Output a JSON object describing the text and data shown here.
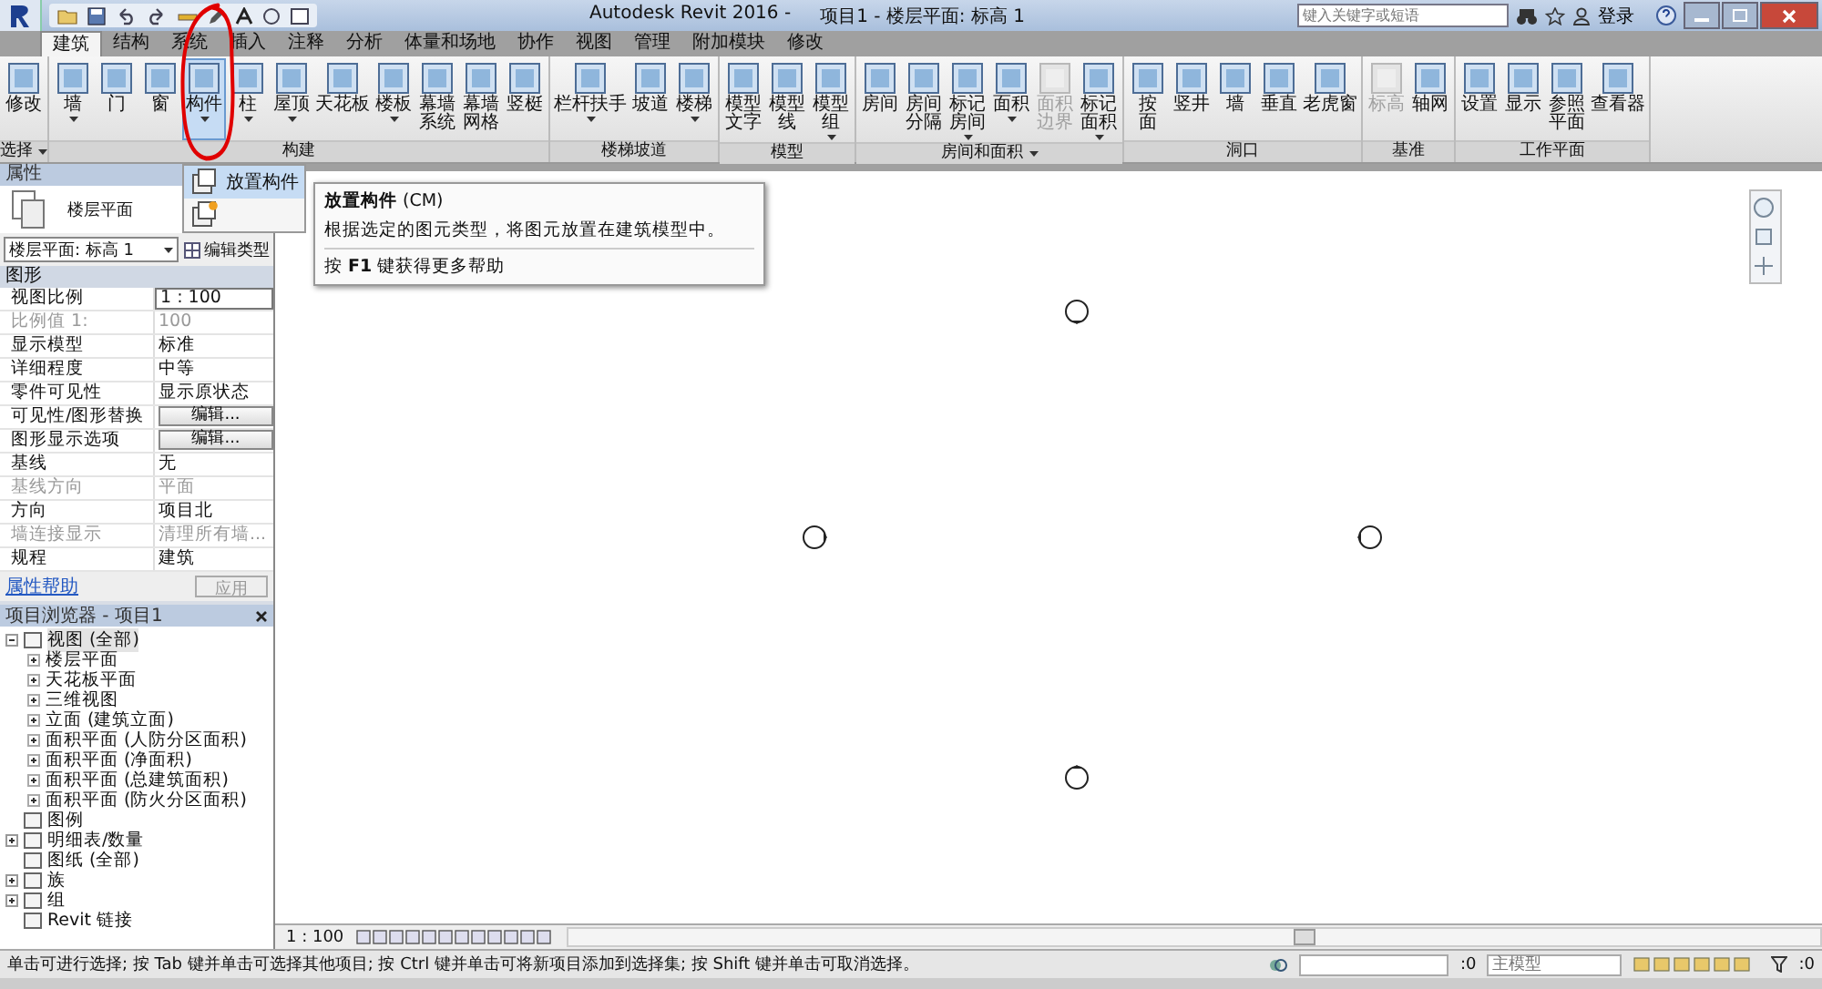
{
  "window": {
    "app_title": "Autodesk Revit 2016 -",
    "doc_title": "项目1 - 楼层平面: 标高 1",
    "search_placeholder": "键入关键字或短语",
    "login": "登录"
  },
  "tabs": [
    {
      "label": "建筑",
      "selected": true
    },
    {
      "label": "结构",
      "selected": false
    },
    {
      "label": "系统",
      "selected": false
    },
    {
      "label": "插入",
      "selected": false
    },
    {
      "label": "注释",
      "selected": false
    },
    {
      "label": "分析",
      "selected": false
    },
    {
      "label": "体量和场地",
      "selected": false
    },
    {
      "label": "协作",
      "selected": false
    },
    {
      "label": "视图",
      "selected": false
    },
    {
      "label": "管理",
      "selected": false
    },
    {
      "label": "附加模块",
      "selected": false
    },
    {
      "label": "修改",
      "selected": false
    }
  ],
  "ribbon_panels": [
    {
      "label": "选择",
      "menu": true,
      "tools": [
        {
          "label": "修改",
          "dropdown": false,
          "selected": false,
          "disabled": false
        }
      ]
    },
    {
      "label": "构建",
      "menu": false,
      "tools": [
        {
          "label": "墙",
          "dropdown": true,
          "selected": false,
          "disabled": false
        },
        {
          "label": "门",
          "dropdown": false,
          "selected": false,
          "disabled": false
        },
        {
          "label": "窗",
          "dropdown": false,
          "selected": false,
          "disabled": false
        },
        {
          "label": "构件",
          "dropdown": true,
          "selected": true,
          "disabled": false
        },
        {
          "label": "柱",
          "dropdown": true,
          "selected": false,
          "disabled": false
        },
        {
          "label": "屋顶",
          "dropdown": true,
          "selected": false,
          "disabled": false
        },
        {
          "label": "天花板",
          "dropdown": false,
          "selected": false,
          "disabled": false
        },
        {
          "label": "楼板",
          "dropdown": true,
          "selected": false,
          "disabled": false
        },
        {
          "label": "幕墙系统",
          "wrapped": true,
          "dropdown": false,
          "selected": false,
          "disabled": false
        },
        {
          "label": "幕墙网格",
          "wrapped": true,
          "dropdown": false,
          "selected": false,
          "disabled": false
        },
        {
          "label": "竖梃",
          "dropdown": false,
          "selected": false,
          "disabled": false
        }
      ]
    },
    {
      "label": "楼梯坡道",
      "menu": false,
      "tools": [
        {
          "label": "栏杆扶手",
          "dropdown": true,
          "selected": false,
          "disabled": false
        },
        {
          "label": "坡道",
          "dropdown": false,
          "selected": false,
          "disabled": false
        },
        {
          "label": "楼梯",
          "dropdown": true,
          "selected": false,
          "disabled": false
        }
      ]
    },
    {
      "label": "模型",
      "menu": false,
      "tools": [
        {
          "label": "模型文字",
          "wrapped": true,
          "dropdown": false,
          "selected": false,
          "disabled": false
        },
        {
          "label": "模型线",
          "wrapped": true,
          "dropdown": false,
          "selected": false,
          "disabled": false
        },
        {
          "label": "模型组",
          "wrapped": true,
          "dropdown": true,
          "selected": false,
          "disabled": false
        }
      ]
    },
    {
      "label": "房间和面积",
      "menu": true,
      "tools": [
        {
          "label": "房间",
          "dropdown": false,
          "selected": false,
          "disabled": false
        },
        {
          "label": "房间分隔",
          "wrapped": true,
          "dropdown": false,
          "selected": false,
          "disabled": false
        },
        {
          "label": "标记房间",
          "wrapped": true,
          "dropdown": true,
          "selected": false,
          "disabled": false
        },
        {
          "label": "面积",
          "dropdown": true,
          "selected": false,
          "disabled": false
        },
        {
          "label": "面积边界",
          "wrapped": true,
          "dropdown": false,
          "selected": false,
          "disabled": true
        },
        {
          "label": "标记面积",
          "wrapped": true,
          "dropdown": true,
          "selected": false,
          "disabled": false
        }
      ]
    },
    {
      "label": "洞口",
      "menu": false,
      "tools": [
        {
          "label": "按面",
          "wrapped": true,
          "dropdown": false,
          "selected": false,
          "disabled": false
        },
        {
          "label": "竖井",
          "dropdown": false,
          "selected": false,
          "disabled": false
        },
        {
          "label": "墙",
          "dropdown": false,
          "selected": false,
          "disabled": false
        },
        {
          "label": "垂直",
          "dropdown": false,
          "selected": false,
          "disabled": false
        },
        {
          "label": "老虎窗",
          "dropdown": false,
          "selected": false,
          "disabled": false
        }
      ]
    },
    {
      "label": "基准",
      "menu": false,
      "tools": [
        {
          "label": "标高",
          "dropdown": false,
          "selected": false,
          "disabled": true
        },
        {
          "label": "轴网",
          "dropdown": false,
          "selected": false,
          "disabled": false
        }
      ]
    },
    {
      "label": "工作平面",
      "menu": false,
      "tools": [
        {
          "label": "设置",
          "dropdown": false,
          "selected": false,
          "disabled": false
        },
        {
          "label": "显示",
          "dropdown": false,
          "selected": false,
          "disabled": false
        },
        {
          "label": "参照平面",
          "wrapped": true,
          "dropdown": false,
          "selected": false,
          "disabled": false
        },
        {
          "label": "查看器",
          "dropdown": false,
          "selected": false,
          "disabled": false
        }
      ]
    }
  ],
  "component_menu": {
    "items": [
      {
        "label": "放置构件",
        "selected": true
      },
      {
        "selected": false
      }
    ]
  },
  "tooltip": {
    "title": "**放置构件** (CM)",
    "description": "根据选定的图元类型，将图元放置在建筑模型中。",
    "help": "按 **F1** 键获得更多帮助"
  },
  "properties": {
    "title": "属性",
    "type_name": "楼层平面",
    "selector": "楼层平面: 标高 1",
    "edit_type": "编辑类型",
    "group": "图形",
    "rows": [
      {
        "label": "视图比例",
        "value": "1 : 100",
        "kind": "input",
        "disabled": false
      },
      {
        "label": "比例值 1:",
        "value": "100",
        "kind": "text",
        "disabled": true
      },
      {
        "label": "显示模型",
        "value": "标准",
        "kind": "text",
        "disabled": false
      },
      {
        "label": "详细程度",
        "value": "中等",
        "kind": "text",
        "disabled": false
      },
      {
        "label": "零件可见性",
        "value": "显示原状态",
        "kind": "text",
        "disabled": false
      },
      {
        "label": "可见性/图形替换",
        "value": "编辑...",
        "kind": "button",
        "disabled": false
      },
      {
        "label": "图形显示选项",
        "value": "编辑...",
        "kind": "button",
        "disabled": false
      },
      {
        "label": "基线",
        "value": "无",
        "kind": "text",
        "disabled": false
      },
      {
        "label": "基线方向",
        "value": "平面",
        "kind": "text",
        "disabled": true
      },
      {
        "label": "方向",
        "value": "项目北",
        "kind": "text",
        "disabled": false
      },
      {
        "label": "墙连接显示",
        "value": "清理所有墙...",
        "kind": "text",
        "disabled": true
      },
      {
        "label": "规程",
        "value": "建筑",
        "kind": "text",
        "disabled": false
      }
    ],
    "help_link": "属性帮助",
    "apply": "应用"
  },
  "project_browser": {
    "title": "项目浏览器 - 项目1",
    "items": [
      {
        "label": "视图 (全部)",
        "expanded": true,
        "selected": true,
        "children": [
          {
            "label": "楼层平面",
            "expanded": false
          },
          {
            "label": "天花板平面",
            "expanded": false
          },
          {
            "label": "三维视图",
            "expanded": false
          },
          {
            "label": "立面 (建筑立面)",
            "expanded": false
          },
          {
            "label": "面积平面 (人防分区面积)",
            "expanded": false
          },
          {
            "label": "面积平面 (净面积)",
            "expanded": false
          },
          {
            "label": "面积平面 (总建筑面积)",
            "expanded": false
          },
          {
            "label": "面积平面 (防火分区面积)",
            "expanded": false
          }
        ]
      },
      {
        "label": "图例"
      },
      {
        "label": "明细表/数量",
        "expanded": false
      },
      {
        "label": "图纸 (全部)"
      },
      {
        "label": "族",
        "expanded": false
      },
      {
        "label": "组",
        "expanded": false
      },
      {
        "label": "Revit 链接"
      }
    ]
  },
  "view_control": {
    "scale": "1 : 100"
  },
  "status_bar": {
    "message": "单击可进行选择; 按 Tab 键并单击可选择其他项目; 按 Ctrl 键并单击可将新项目添加到选择集; 按 Shift 键并单击可取消选择。",
    "selection_count": ":0",
    "workset": "主模型",
    "filter_count": ":0"
  }
}
